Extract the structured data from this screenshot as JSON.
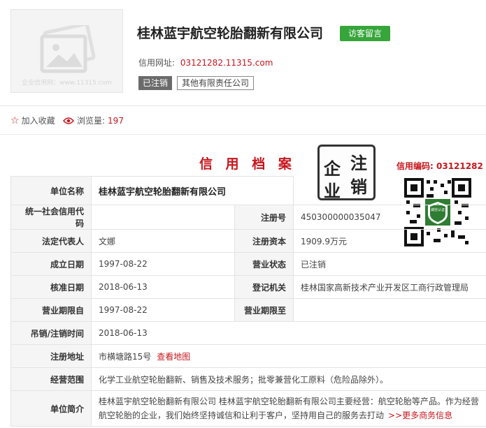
{
  "company": {
    "name": "桂林蓝宇航空轮胎翻新有限公司",
    "visit_button": "访客留言",
    "credit_url_label": "信用网址:",
    "credit_url_value": "03121282.11315.com",
    "status": "已注销",
    "type": "其他有限责任公司",
    "logo_watermark": "企业信用网：www.11315.com"
  },
  "actions": {
    "favorite": "加入收藏",
    "views_label": "浏览量:",
    "views_count": "197"
  },
  "archive": {
    "title": "信 用 档 案",
    "stamp_chars": [
      "企",
      "注",
      "业",
      "销"
    ],
    "credit_code_label": "信用编码:",
    "credit_code_value": "03121282",
    "qr_badge": "诚信认证"
  },
  "table": {
    "name_label": "单位名称",
    "name_value": "桂林蓝宇航空轮胎翻新有限公司",
    "uscc_label": "统一社会信用代码",
    "uscc_value": "",
    "reg_no_label": "注册号",
    "reg_no_value": "450300000035047",
    "legal_rep_label": "法定代表人",
    "legal_rep_value": "文娜",
    "capital_label": "注册资本",
    "capital_value": "1909.9万元",
    "est_date_label": "成立日期",
    "est_date_value": "1997-08-22",
    "biz_status_label": "营业状态",
    "biz_status_value": "已注销",
    "approve_date_label": "核准日期",
    "approve_date_value": "2018-06-13",
    "reg_authority_label": "登记机关",
    "reg_authority_value": "桂林国家高新技术产业开发区工商行政管理局",
    "term_from_label": "营业期限自",
    "term_from_value": "1997-08-22",
    "term_to_label": "营业期限至",
    "term_to_value": "",
    "revoke_label": "吊销/注销时间",
    "revoke_value": "2018-06-13",
    "address_label": "注册地址",
    "address_value": "市横塘路15号",
    "map_link": "查看地图",
    "scope_label": "经营范围",
    "scope_value": "化学工业航空轮胎翻新、销售及技术服务；批零兼营化工原料（危险品除外）。",
    "intro_label": "单位简介",
    "intro_value": "桂林蓝宇航空轮胎翻新有限公司 桂林蓝宇航空轮胎翻新有限公司主要经营：航空轮胎等产品。作为经营航空轮胎的企业，我们始终坚持诚信和让利于客户，坚持用自己的服务去打动",
    "more_link": ">>更多商务信息"
  },
  "colors": {
    "accent_red": "#c8161d",
    "green_button": "#36a53a"
  }
}
